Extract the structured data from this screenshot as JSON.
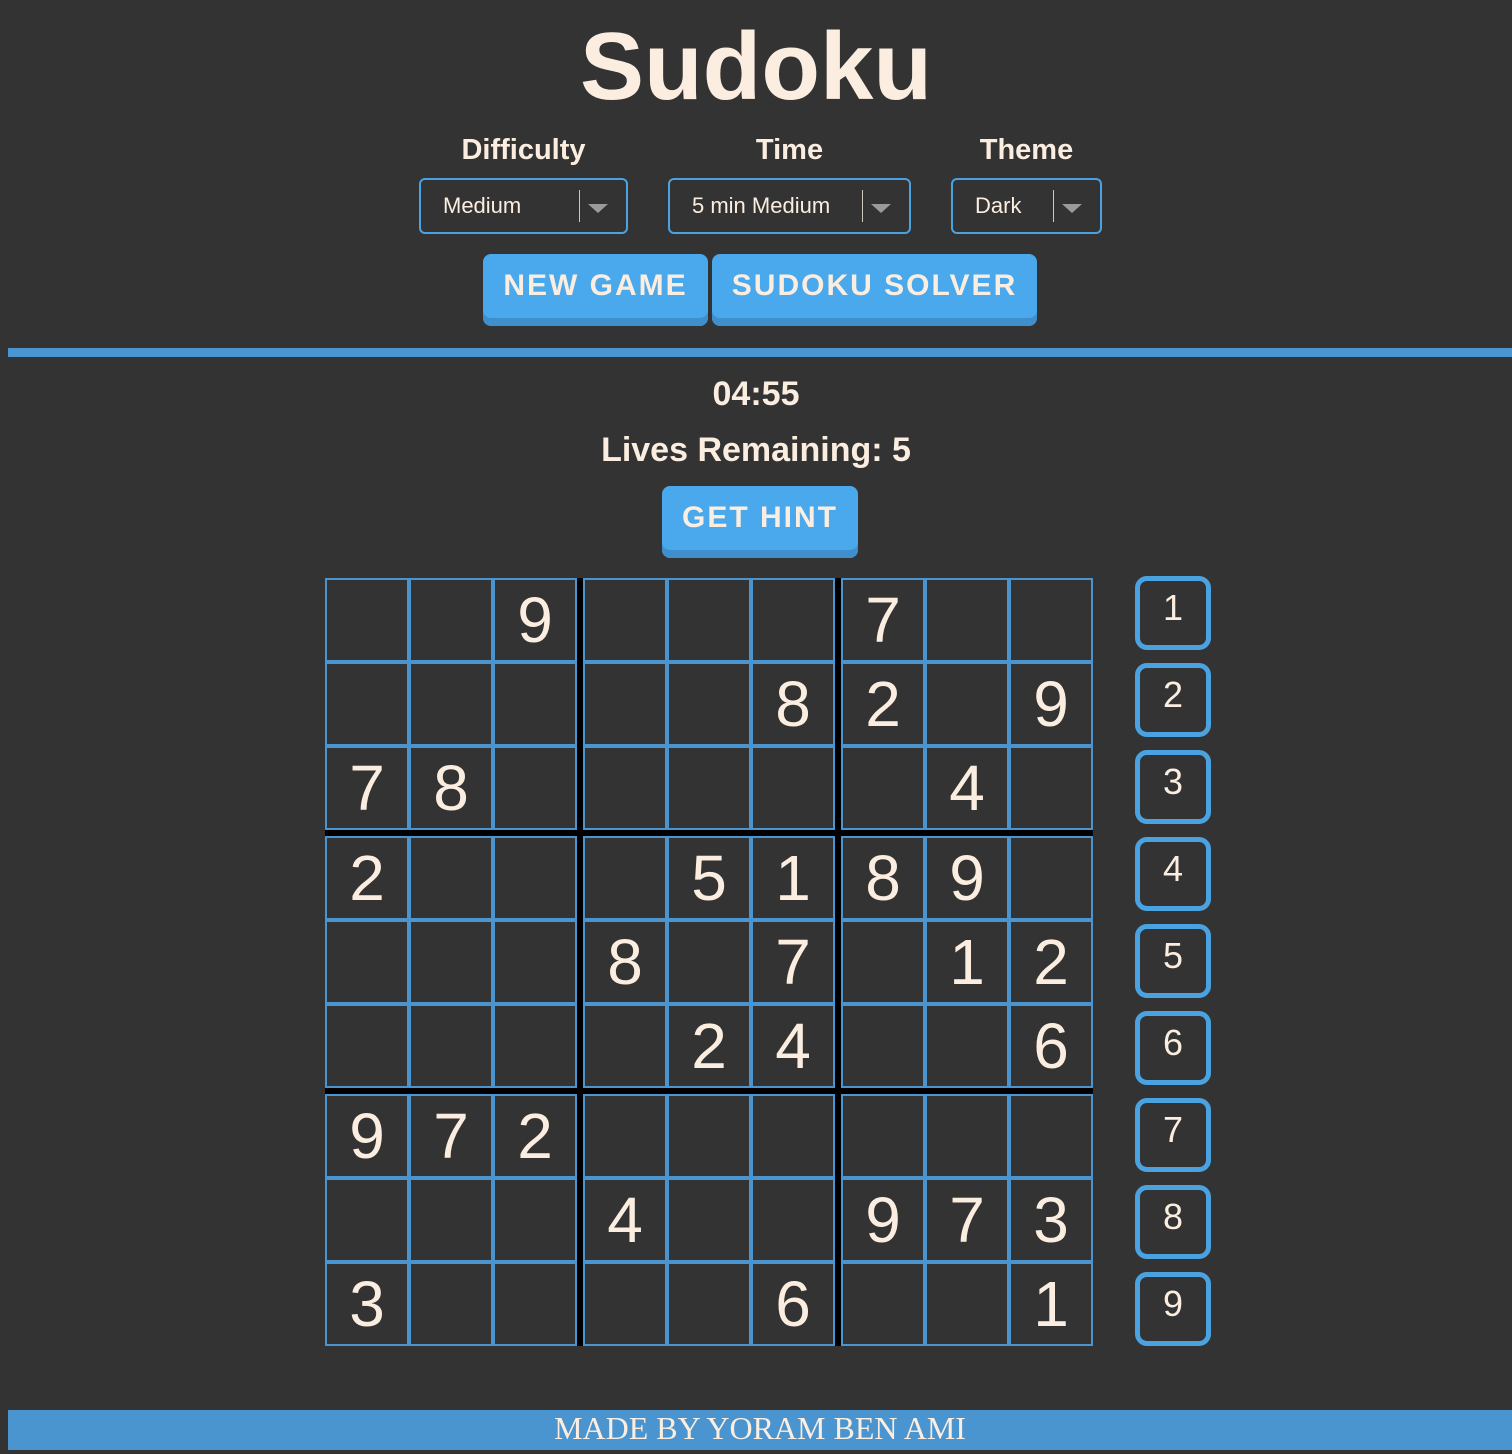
{
  "header": {
    "title": "Sudoku"
  },
  "controls": {
    "difficulty": {
      "label": "Difficulty",
      "value": "Medium"
    },
    "time": {
      "label": "Time",
      "value": "5 min Medium"
    },
    "theme": {
      "label": "Theme",
      "value": "Dark"
    }
  },
  "buttons": {
    "new_game": "NEW GAME",
    "solver": "SUDOKU SOLVER",
    "hint": "GET HINT"
  },
  "status": {
    "timer": "04:55",
    "lives": "Lives Remaining: 5"
  },
  "board": {
    "grid": [
      [
        "",
        "",
        "9",
        "",
        "",
        "",
        "7",
        "",
        ""
      ],
      [
        "",
        "",
        "",
        "",
        "",
        "8",
        "2",
        "",
        "9"
      ],
      [
        "7",
        "8",
        "",
        "",
        "",
        "",
        "",
        "4",
        ""
      ],
      [
        "2",
        "",
        "",
        "",
        "5",
        "1",
        "8",
        "9",
        ""
      ],
      [
        "",
        "",
        "",
        "8",
        "",
        "7",
        "",
        "1",
        "2"
      ],
      [
        "",
        "",
        "",
        "",
        "2",
        "4",
        "",
        "",
        "6"
      ],
      [
        "9",
        "7",
        "2",
        "",
        "",
        "",
        "",
        "",
        ""
      ],
      [
        "",
        "",
        "",
        "4",
        "",
        "",
        "9",
        "7",
        "3"
      ],
      [
        "3",
        "",
        "",
        "",
        "",
        "6",
        "",
        "",
        "1"
      ]
    ]
  },
  "numpad": [
    "1",
    "2",
    "3",
    "4",
    "5",
    "6",
    "7",
    "8",
    "9"
  ],
  "footer": {
    "text": "MADE BY YORAM BEN AMI"
  },
  "colors": {
    "background": "#333333",
    "accent": "#4aa8ec",
    "text": "#fbeee0"
  }
}
